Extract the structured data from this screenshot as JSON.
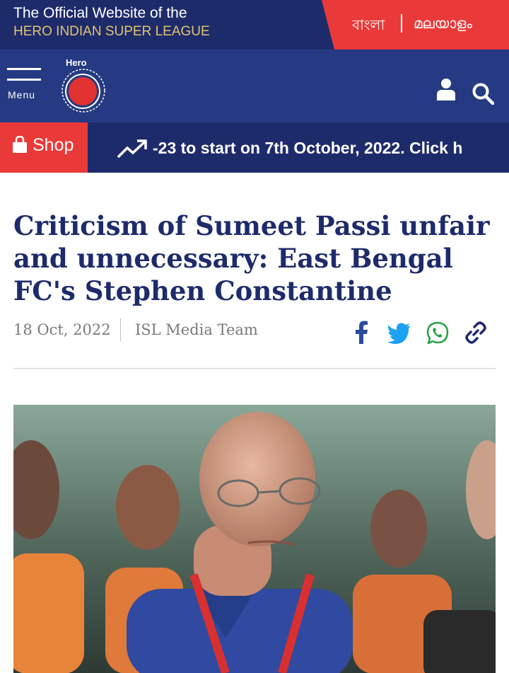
{
  "header": {
    "title_line1": "The Official Website of the",
    "title_line2": "HERO INDIAN SUPER LEAGUE",
    "languages": [
      "বাংলা",
      "മലയാളം"
    ]
  },
  "nav": {
    "menu_label": "Menu",
    "logo_text": "Hero",
    "icons": [
      "user-icon",
      "search-icon"
    ]
  },
  "shop": {
    "label": "Shop"
  },
  "ticker": {
    "text": "-23 to start on 7th October, 2022. Click h"
  },
  "article": {
    "headline": "Criticism of Sumeet Passi unfair and unnecessary: East Bengal FC's Stephen Constantine",
    "date": "18 Oct, 2022",
    "author": "ISL Media Team",
    "share_icons": [
      "facebook-icon",
      "twitter-icon",
      "whatsapp-icon",
      "link-icon"
    ]
  },
  "colors": {
    "navy": "#1e2b6b",
    "nav_blue": "#253a82",
    "red": "#ea3939",
    "gold": "#e2c46f",
    "headline": "#1e2b6b",
    "twitter": "#1da1f2",
    "whatsapp": "#25a244"
  }
}
